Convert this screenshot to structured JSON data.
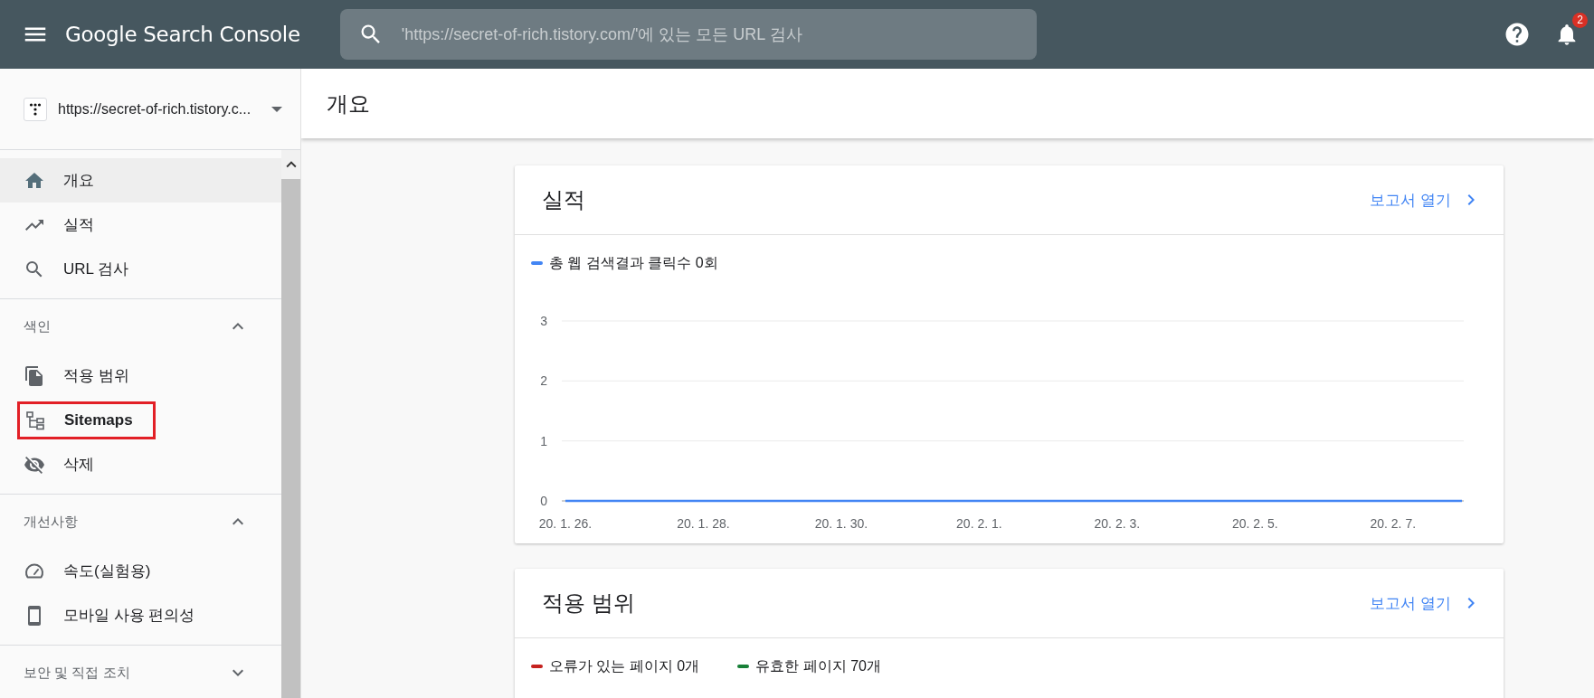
{
  "header": {
    "title": "Google Search Console",
    "search": {
      "placeholder": "'https://secret-of-rich.tistory.com/'에 있는 모든 URL 검사"
    },
    "notifications": {
      "badge": "2"
    }
  },
  "sidebar": {
    "property": {
      "url": "https://secret-of-rich.tistory.c..."
    },
    "items": [
      {
        "label": "개요",
        "selected": true,
        "highlighted": false
      },
      {
        "label": "실적",
        "selected": false,
        "highlighted": false
      },
      {
        "label": "URL 검사",
        "selected": false,
        "highlighted": false
      }
    ],
    "sections": [
      {
        "title": "색인",
        "expanded": true,
        "items": [
          {
            "label": "적용 범위",
            "selected": false,
            "highlighted": false
          },
          {
            "label": "Sitemaps",
            "selected": false,
            "highlighted": true
          },
          {
            "label": "삭제",
            "selected": false,
            "highlighted": false
          }
        ]
      },
      {
        "title": "개선사항",
        "expanded": true,
        "items": [
          {
            "label": "속도(실험용)",
            "selected": false,
            "highlighted": false
          },
          {
            "label": "모바일 사용 편의성",
            "selected": false,
            "highlighted": false
          }
        ]
      },
      {
        "title": "보안 및 직접 조치",
        "expanded": false
      }
    ]
  },
  "main": {
    "title": "개요",
    "cards": [
      {
        "kind": "chart",
        "title": "실적",
        "link": "보고서 열기",
        "chart_data": {
          "type": "line",
          "categories": [
            "20. 1. 26.",
            null,
            "20. 1. 28.",
            null,
            "20. 1. 30.",
            null,
            "20. 2. 1.",
            null,
            "20. 2. 3.",
            null,
            "20. 2. 5.",
            null,
            "20. 2. 7.",
            null
          ],
          "ylim": [
            0,
            3
          ],
          "yticks": [
            0,
            1,
            2,
            3
          ],
          "series": [
            {
              "name": "총 웹 검색결과 클릭수 0회",
              "color": "#4285f4",
              "values": [
                0,
                0,
                0,
                0,
                0,
                0,
                0,
                0,
                0,
                0,
                0,
                0,
                0,
                0
              ]
            }
          ]
        }
      },
      {
        "kind": "legend",
        "title": "적용 범위",
        "link": "보고서 열기",
        "legend": [
          {
            "label": "오류가 있는 페이지 0개",
            "color": "#c5221f"
          },
          {
            "label": "유효한 페이지 70개",
            "color": "#188038"
          }
        ]
      }
    ]
  }
}
